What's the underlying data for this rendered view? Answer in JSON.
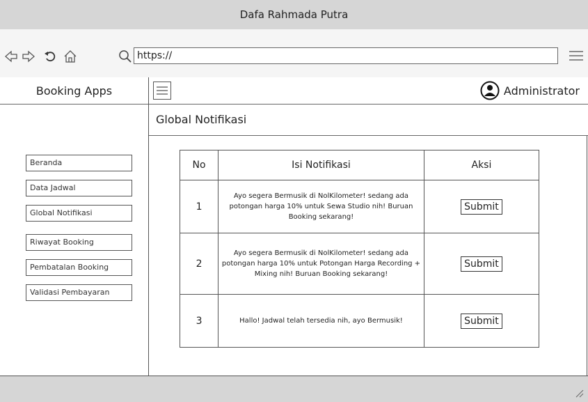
{
  "window": {
    "title": "Dafa Rahmada Putra"
  },
  "browser": {
    "url": "https://"
  },
  "sidebar": {
    "app_name": "Booking Apps",
    "items": [
      {
        "label": "Beranda"
      },
      {
        "label": "Data Jadwal"
      },
      {
        "label": "Global Notifikasi"
      },
      {
        "label": "Riwayat Booking"
      },
      {
        "label": "Pembatalan Booking"
      },
      {
        "label": "Validasi Pembayaran"
      }
    ]
  },
  "header": {
    "user_label": "Administrator"
  },
  "main": {
    "title": "Global Notifikasi",
    "table": {
      "headers": [
        "No",
        "Isi Notifikasi",
        "Aksi"
      ],
      "rows": [
        {
          "no": "1",
          "message": "Ayo segera Bermusik di NolKilometer! sedang ada potongan harga 10% untuk Sewa Studio nih! Buruan Booking sekarang!",
          "action": "Submit"
        },
        {
          "no": "2",
          "message": "Ayo segera Bermusik di NolKilometer! sedang ada potongan harga 10% untuk Potongan Harga Recording + Mixing nih! Buruan Booking sekarang!",
          "action": "Submit"
        },
        {
          "no": "3",
          "message": "Hallo! Jadwal telah tersedia nih, ayo Bermusik!",
          "action": "Submit"
        }
      ]
    }
  },
  "icons": {
    "back": "back-arrow-icon",
    "forward": "forward-arrow-icon",
    "reload": "reload-icon",
    "home": "home-icon",
    "search": "search-icon",
    "menu": "hamburger-icon",
    "user": "user-icon",
    "resize": "resize-grip-icon"
  }
}
